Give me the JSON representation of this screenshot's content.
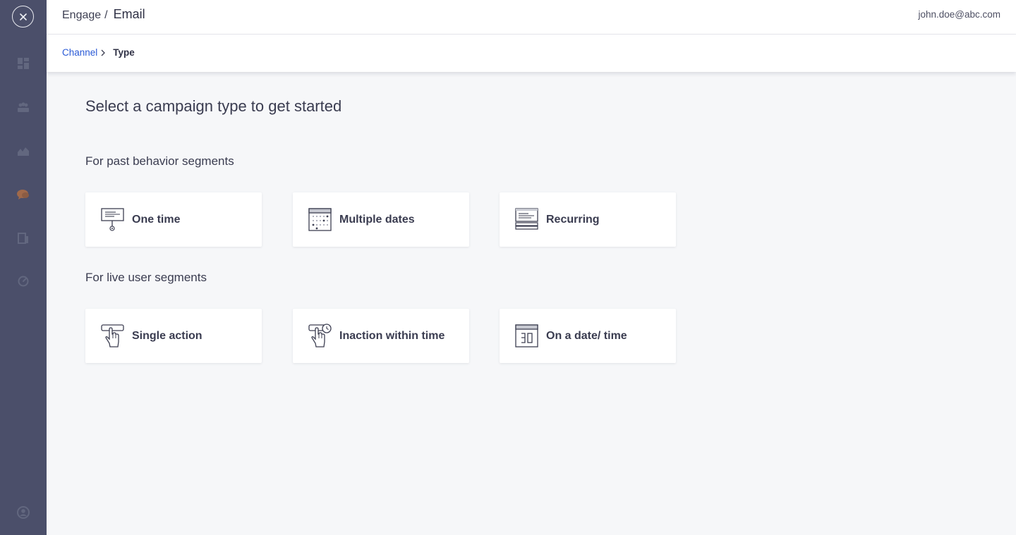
{
  "header": {
    "title_parent": "Engage",
    "title_separator": "/",
    "title_current": "Email",
    "user_email": "john.doe@abc.com"
  },
  "breadcrumb": {
    "link_label": "Channel",
    "current_label": "Type"
  },
  "main": {
    "title": "Select a campaign type to get started",
    "sections": [
      {
        "title": "For past behavior segments",
        "cards": [
          {
            "label": "One time",
            "icon": "billboard-pin-icon"
          },
          {
            "label": "Multiple dates",
            "icon": "calendar-grid-icon"
          },
          {
            "label": "Recurring",
            "icon": "stacked-sheets-icon"
          }
        ]
      },
      {
        "title": "For live user segments",
        "cards": [
          {
            "label": "Single action",
            "icon": "hand-pointer-icon"
          },
          {
            "label": "Inaction within time",
            "icon": "hand-clock-icon"
          },
          {
            "label": "On a date/ time",
            "icon": "calendar-date-icon"
          }
        ]
      }
    ]
  },
  "sidebar": {
    "icons": [
      "dashboard-icon",
      "segments-icon",
      "analytics-icon",
      "engage-icon",
      "content-icon",
      "speed-icon",
      "account-icon"
    ]
  },
  "colors": {
    "sidebar": "#4b4f6a",
    "link": "#2a5ad6",
    "background": "#f6f7f9",
    "active_nav": "#a0694a"
  }
}
